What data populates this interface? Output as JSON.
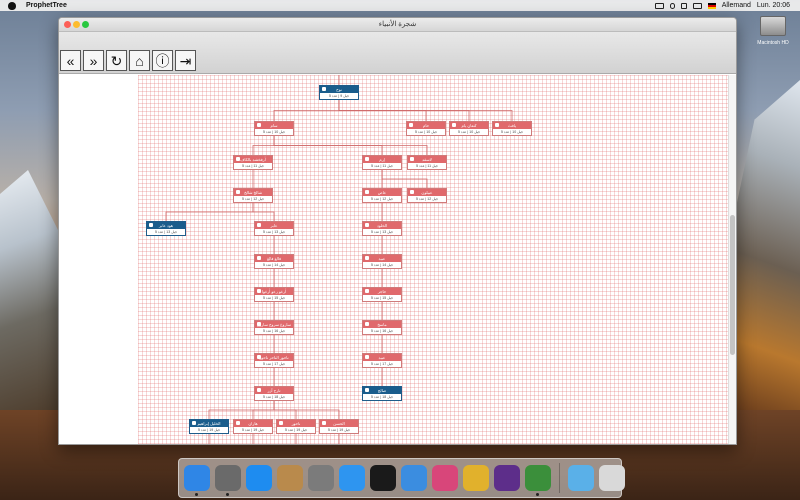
{
  "menubar": {
    "app_name": "ProphetTree",
    "language": "Allemand",
    "clock": "Lun. 20:06"
  },
  "desktop": {
    "drive_label": "Macintosh HD"
  },
  "window": {
    "title": "شجرة الأنبياء"
  },
  "toolbar": {
    "buttons": [
      {
        "name": "back-button",
        "glyph": "«"
      },
      {
        "name": "forward-button",
        "glyph": "»"
      },
      {
        "name": "refresh-button",
        "glyph": "↻"
      },
      {
        "name": "home-button",
        "glyph": "⌂"
      },
      {
        "name": "info-button",
        "glyph": "ⓘ"
      },
      {
        "name": "exit-button",
        "glyph": "⇥"
      }
    ]
  },
  "tree": {
    "colors": {
      "prophet": "#1a5d8c",
      "person": "#e0696c",
      "line": "#d06a6a"
    },
    "nodes": [
      {
        "id": "n1",
        "name": "نوح",
        "stat": "جيل 9 | عدد 5",
        "prophet": true
      },
      {
        "id": "n2",
        "name": "سام",
        "stat": "جيل 10 | عدد 5"
      },
      {
        "id": "n3",
        "name": "حام",
        "stat": "جيل 10 | عدد 5"
      },
      {
        "id": "n4",
        "name": "كنعان يام",
        "stat": "جيل 10 | عدد 5"
      },
      {
        "id": "n5",
        "name": "يافث",
        "stat": "جيل 10 | عدد 5"
      },
      {
        "id": "n6",
        "name": "أرفخشد بالكاف",
        "stat": "جيل 11 | عدد 5"
      },
      {
        "id": "n7",
        "name": "إرم",
        "stat": "جيل 11 | عدد 5"
      },
      {
        "id": "n8",
        "name": "لاسقد",
        "stat": "جيل 11 | عدد 5"
      },
      {
        "id": "n9",
        "name": "شالخ شالخ",
        "stat": "جيل 12 | عدد 5"
      },
      {
        "id": "n10",
        "name": "عاص",
        "stat": "جيل 12 | عدد 5"
      },
      {
        "id": "n11",
        "name": "عبيلون",
        "stat": "جيل 12 | عدد 5"
      },
      {
        "id": "n12",
        "name": "هود عابر",
        "stat": "جيل 13 | عدد 5",
        "prophet": true
      },
      {
        "id": "n13",
        "name": "عابر",
        "stat": "جيل 13 | عدد 5"
      },
      {
        "id": "n14",
        "name": "الخلود",
        "stat": "جيل 13 | عدد 5"
      },
      {
        "id": "n15",
        "name": "فالغ فالغ",
        "stat": "جيل 14 | عدد 5"
      },
      {
        "id": "n16",
        "name": "عبيد",
        "stat": "جيل 14 | عدد 5"
      },
      {
        "id": "n17",
        "name": "أرغو رعو أرغوا",
        "stat": "جيل 15 | عدد 5"
      },
      {
        "id": "n18",
        "name": "حاجر",
        "stat": "جيل 15 | عدد 5"
      },
      {
        "id": "n19",
        "name": "ساروغ سروج ساروغ",
        "stat": "جيل 16 | عدد 5"
      },
      {
        "id": "n20",
        "name": "ماسخ",
        "stat": "جيل 16 | عدد 5"
      },
      {
        "id": "n21",
        "name": "ناحور الناحر ناحور",
        "stat": "جيل 17 | عدد 5"
      },
      {
        "id": "n22",
        "name": "عبيد",
        "stat": "جيل 17 | عدد 5"
      },
      {
        "id": "n23",
        "name": "تارح آزر",
        "stat": "جيل 18 | عدد 5"
      },
      {
        "id": "n24",
        "name": "صالح",
        "stat": "جيل 18 | عدد 5",
        "prophet": true
      },
      {
        "id": "n25",
        "name": "الخليل إبراهيم",
        "stat": "جيل 19 | عدد 5",
        "prophet": true
      },
      {
        "id": "n26",
        "name": "هاران",
        "stat": "جيل 19 | عدد 5"
      },
      {
        "id": "n27",
        "name": "ناحور",
        "stat": "جيل 19 | عدد 5"
      },
      {
        "id": "n28",
        "name": "الحسن",
        "stat": "جيل 19 | عدد 5"
      }
    ],
    "edges": [
      [
        "n1",
        "n2"
      ],
      [
        "n1",
        "n3"
      ],
      [
        "n1",
        "n4"
      ],
      [
        "n1",
        "n5"
      ],
      [
        "n2",
        "n6"
      ],
      [
        "n2",
        "n7"
      ],
      [
        "n2",
        "n8"
      ],
      [
        "n6",
        "n9"
      ],
      [
        "n7",
        "n10"
      ],
      [
        "n7",
        "n11"
      ],
      [
        "n9",
        "n12"
      ],
      [
        "n9",
        "n13"
      ],
      [
        "n10",
        "n14"
      ],
      [
        "n13",
        "n15"
      ],
      [
        "n14",
        "n16"
      ],
      [
        "n15",
        "n17"
      ],
      [
        "n16",
        "n18"
      ],
      [
        "n17",
        "n19"
      ],
      [
        "n18",
        "n20"
      ],
      [
        "n19",
        "n21"
      ],
      [
        "n20",
        "n22"
      ],
      [
        "n21",
        "n23"
      ],
      [
        "n22",
        "n24"
      ],
      [
        "n23",
        "n25"
      ],
      [
        "n23",
        "n26"
      ],
      [
        "n23",
        "n27"
      ],
      [
        "n23",
        "n28"
      ]
    ]
  },
  "dock": {
    "apps": [
      {
        "name": "finder",
        "color": "#2f86e6"
      },
      {
        "name": "launchpad",
        "color": "#6a6a6a"
      },
      {
        "name": "app-store",
        "color": "#1e8cf0"
      },
      {
        "name": "notes",
        "color": "#b98a4c"
      },
      {
        "name": "system-preferences",
        "color": "#7b7b7b"
      },
      {
        "name": "safari",
        "color": "#2e95f0"
      },
      {
        "name": "terminal",
        "color": "#1a1a1a"
      },
      {
        "name": "xcode",
        "color": "#3b8de0"
      },
      {
        "name": "display-utility",
        "color": "#d8467a"
      },
      {
        "name": "chrome",
        "color": "#e1b12c"
      },
      {
        "name": "visual-studio",
        "color": "#5d2e8a"
      },
      {
        "name": "prophet-tree",
        "color": "#3b8f3b"
      },
      {
        "name": "downloads",
        "color": "#5ab0e8"
      },
      {
        "name": "trash",
        "color": "#d9d9d9"
      }
    ]
  }
}
